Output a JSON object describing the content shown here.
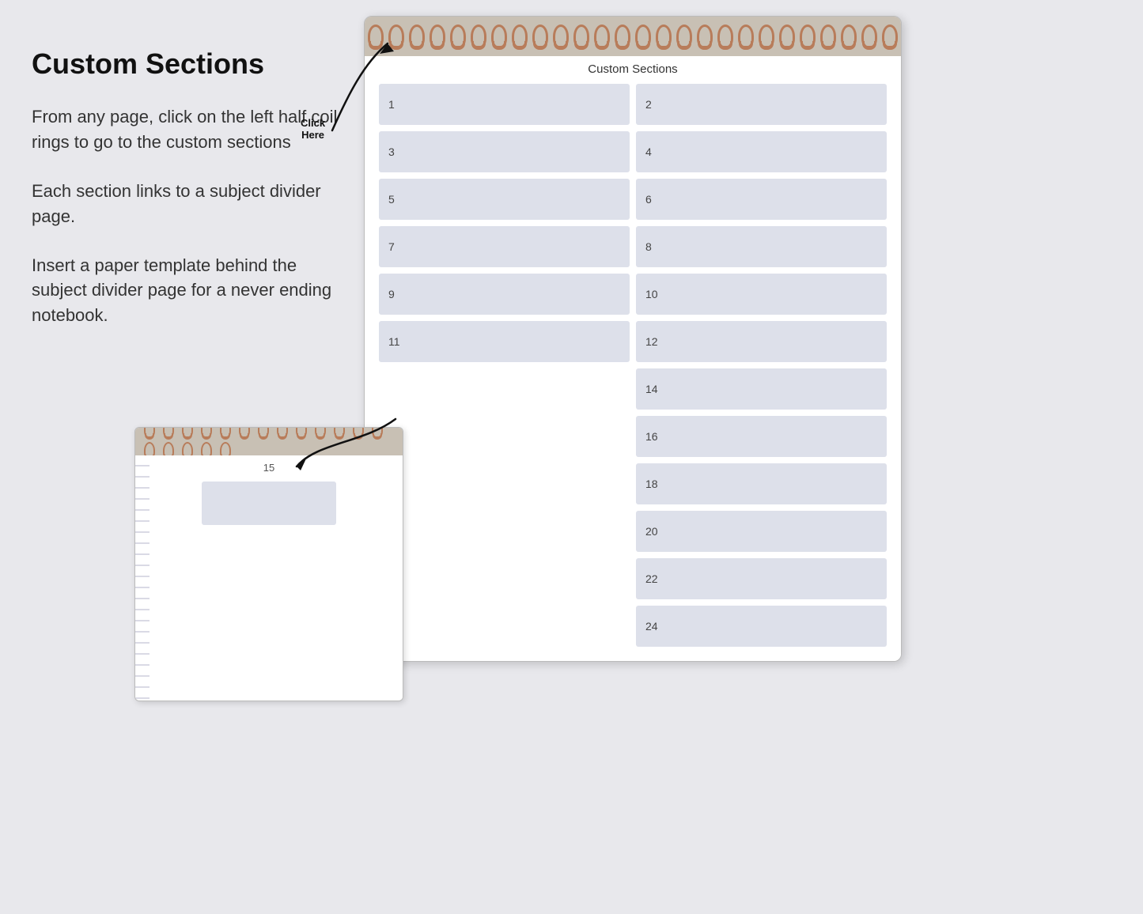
{
  "page": {
    "background": "#e8e8ec"
  },
  "left_panel": {
    "title": "Custom Sections",
    "description_1": "From any page, click on the left half coil rings to go to the custom sections",
    "description_2": "Each section links to a subject divider page.",
    "description_3": "Insert a paper template behind the subject divider page for a never ending notebook.",
    "click_here": "Click\nHere"
  },
  "main_notebook": {
    "custom_sections_label": "Custom Sections",
    "sections": [
      {
        "id": 1,
        "num": "1"
      },
      {
        "id": 2,
        "num": "2"
      },
      {
        "id": 3,
        "num": "3"
      },
      {
        "id": 4,
        "num": "4"
      },
      {
        "id": 5,
        "num": "5"
      },
      {
        "id": 6,
        "num": "6"
      },
      {
        "id": 7,
        "num": "7"
      },
      {
        "id": 8,
        "num": "8"
      },
      {
        "id": 9,
        "num": "9"
      },
      {
        "id": 10,
        "num": "10"
      },
      {
        "id": 11,
        "num": "11"
      },
      {
        "id": 12,
        "num": "12"
      },
      {
        "id": 13,
        "num": ""
      },
      {
        "id": 14,
        "num": "14"
      },
      {
        "id": 15,
        "num": ""
      },
      {
        "id": 16,
        "num": "16"
      },
      {
        "id": 17,
        "num": ""
      },
      {
        "id": 18,
        "num": "18"
      },
      {
        "id": 19,
        "num": ""
      },
      {
        "id": 20,
        "num": "20"
      },
      {
        "id": 21,
        "num": ""
      },
      {
        "id": 22,
        "num": "22"
      },
      {
        "id": 23,
        "num": ""
      },
      {
        "id": 24,
        "num": "24"
      }
    ]
  },
  "small_notebook": {
    "page_number": "15"
  }
}
